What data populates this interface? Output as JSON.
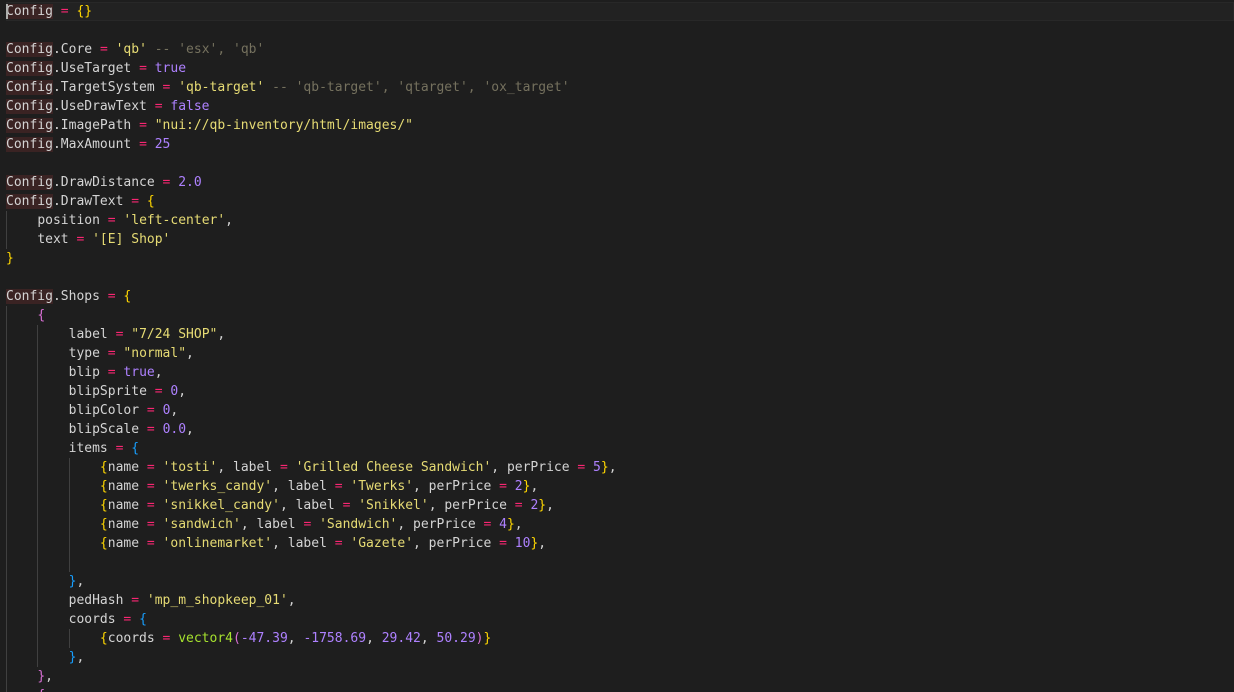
{
  "colors": {
    "background": "#1e1e1e",
    "plain": "#d4d4d4",
    "string": "#e6db74",
    "comment": "#75715e",
    "number": "#ae81ff",
    "operator": "#f92672",
    "bracket_gold": "#ffd700",
    "bracket_purple": "#da70d6",
    "bracket_blue": "#179fff",
    "function": "#a6e22e",
    "config_highlight": "#3a2323"
  },
  "editor": {
    "cursor_line": 0,
    "lines": [
      {
        "indent": 0,
        "tokens": [
          {
            "t": "Config",
            "c": "kw"
          },
          {
            "t": " "
          },
          {
            "t": "=",
            "c": "op"
          },
          {
            "t": " "
          },
          {
            "t": "{}",
            "c": "b1"
          }
        ]
      },
      {
        "indent": 0,
        "tokens": []
      },
      {
        "indent": 0,
        "tokens": [
          {
            "t": "Config",
            "c": "kw"
          },
          {
            "t": ".Core "
          },
          {
            "t": "=",
            "c": "op"
          },
          {
            "t": " "
          },
          {
            "t": "'qb'",
            "c": "str"
          },
          {
            "t": " -- 'esx', 'qb'",
            "c": "cm"
          }
        ]
      },
      {
        "indent": 0,
        "tokens": [
          {
            "t": "Config",
            "c": "kw"
          },
          {
            "t": ".UseTarget "
          },
          {
            "t": "=",
            "c": "op"
          },
          {
            "t": " "
          },
          {
            "t": "true",
            "c": "num"
          }
        ]
      },
      {
        "indent": 0,
        "tokens": [
          {
            "t": "Config",
            "c": "kw"
          },
          {
            "t": ".TargetSystem "
          },
          {
            "t": "=",
            "c": "op"
          },
          {
            "t": " "
          },
          {
            "t": "'qb-target'",
            "c": "str"
          },
          {
            "t": " -- 'qb-target', 'qtarget', 'ox_target'",
            "c": "cm"
          }
        ]
      },
      {
        "indent": 0,
        "tokens": [
          {
            "t": "Config",
            "c": "kw"
          },
          {
            "t": ".UseDrawText "
          },
          {
            "t": "=",
            "c": "op"
          },
          {
            "t": " "
          },
          {
            "t": "false",
            "c": "num"
          }
        ]
      },
      {
        "indent": 0,
        "tokens": [
          {
            "t": "Config",
            "c": "kw"
          },
          {
            "t": ".ImagePath "
          },
          {
            "t": "=",
            "c": "op"
          },
          {
            "t": " "
          },
          {
            "t": "\"nui://qb-inventory/html/images/\"",
            "c": "str"
          }
        ]
      },
      {
        "indent": 0,
        "tokens": [
          {
            "t": "Config",
            "c": "kw"
          },
          {
            "t": ".MaxAmount "
          },
          {
            "t": "=",
            "c": "op"
          },
          {
            "t": " "
          },
          {
            "t": "25",
            "c": "num"
          }
        ]
      },
      {
        "indent": 0,
        "tokens": []
      },
      {
        "indent": 0,
        "tokens": [
          {
            "t": "Config",
            "c": "kw"
          },
          {
            "t": ".DrawDistance "
          },
          {
            "t": "=",
            "c": "op"
          },
          {
            "t": " "
          },
          {
            "t": "2.0",
            "c": "num"
          }
        ]
      },
      {
        "indent": 0,
        "tokens": [
          {
            "t": "Config",
            "c": "kw"
          },
          {
            "t": ".DrawText "
          },
          {
            "t": "=",
            "c": "op"
          },
          {
            "t": " "
          },
          {
            "t": "{",
            "c": "b1"
          }
        ]
      },
      {
        "indent": 1,
        "tokens": [
          {
            "t": "position "
          },
          {
            "t": "=",
            "c": "op"
          },
          {
            "t": " "
          },
          {
            "t": "'left-center'",
            "c": "str"
          },
          {
            "t": ","
          }
        ]
      },
      {
        "indent": 1,
        "tokens": [
          {
            "t": "text "
          },
          {
            "t": "=",
            "c": "op"
          },
          {
            "t": " "
          },
          {
            "t": "'[E] Shop'",
            "c": "str"
          }
        ]
      },
      {
        "indent": 0,
        "tokens": [
          {
            "t": "}",
            "c": "b1"
          }
        ]
      },
      {
        "indent": 0,
        "tokens": []
      },
      {
        "indent": 0,
        "tokens": [
          {
            "t": "Config",
            "c": "kw"
          },
          {
            "t": ".Shops "
          },
          {
            "t": "=",
            "c": "op"
          },
          {
            "t": " "
          },
          {
            "t": "{",
            "c": "b1"
          }
        ]
      },
      {
        "indent": 1,
        "tokens": [
          {
            "t": "{",
            "c": "b2"
          }
        ]
      },
      {
        "indent": 2,
        "tokens": [
          {
            "t": "label "
          },
          {
            "t": "=",
            "c": "op"
          },
          {
            "t": " "
          },
          {
            "t": "\"7/24 SHOP\"",
            "c": "str"
          },
          {
            "t": ","
          }
        ]
      },
      {
        "indent": 2,
        "tokens": [
          {
            "t": "type "
          },
          {
            "t": "=",
            "c": "op"
          },
          {
            "t": " "
          },
          {
            "t": "\"normal\"",
            "c": "str"
          },
          {
            "t": ","
          }
        ]
      },
      {
        "indent": 2,
        "tokens": [
          {
            "t": "blip "
          },
          {
            "t": "=",
            "c": "op"
          },
          {
            "t": " "
          },
          {
            "t": "true",
            "c": "num"
          },
          {
            "t": ","
          }
        ]
      },
      {
        "indent": 2,
        "tokens": [
          {
            "t": "blipSprite "
          },
          {
            "t": "=",
            "c": "op"
          },
          {
            "t": " "
          },
          {
            "t": "0",
            "c": "num"
          },
          {
            "t": ","
          }
        ]
      },
      {
        "indent": 2,
        "tokens": [
          {
            "t": "blipColor "
          },
          {
            "t": "=",
            "c": "op"
          },
          {
            "t": " "
          },
          {
            "t": "0",
            "c": "num"
          },
          {
            "t": ","
          }
        ]
      },
      {
        "indent": 2,
        "tokens": [
          {
            "t": "blipScale "
          },
          {
            "t": "=",
            "c": "op"
          },
          {
            "t": " "
          },
          {
            "t": "0.0",
            "c": "num"
          },
          {
            "t": ","
          }
        ]
      },
      {
        "indent": 2,
        "tokens": [
          {
            "t": "items "
          },
          {
            "t": "=",
            "c": "op"
          },
          {
            "t": " "
          },
          {
            "t": "{",
            "c": "b3"
          }
        ]
      },
      {
        "indent": 3,
        "tokens": [
          {
            "t": "{",
            "c": "b1"
          },
          {
            "t": "name "
          },
          {
            "t": "=",
            "c": "op"
          },
          {
            "t": " "
          },
          {
            "t": "'tosti'",
            "c": "str"
          },
          {
            "t": ", label "
          },
          {
            "t": "=",
            "c": "op"
          },
          {
            "t": " "
          },
          {
            "t": "'Grilled Cheese Sandwich'",
            "c": "str"
          },
          {
            "t": ", perPrice "
          },
          {
            "t": "=",
            "c": "op"
          },
          {
            "t": " "
          },
          {
            "t": "5",
            "c": "num"
          },
          {
            "t": "}",
            "c": "b1"
          },
          {
            "t": ","
          }
        ]
      },
      {
        "indent": 3,
        "tokens": [
          {
            "t": "{",
            "c": "b1"
          },
          {
            "t": "name "
          },
          {
            "t": "=",
            "c": "op"
          },
          {
            "t": " "
          },
          {
            "t": "'twerks_candy'",
            "c": "str"
          },
          {
            "t": ", label "
          },
          {
            "t": "=",
            "c": "op"
          },
          {
            "t": " "
          },
          {
            "t": "'Twerks'",
            "c": "str"
          },
          {
            "t": ", perPrice "
          },
          {
            "t": "=",
            "c": "op"
          },
          {
            "t": " "
          },
          {
            "t": "2",
            "c": "num"
          },
          {
            "t": "}",
            "c": "b1"
          },
          {
            "t": ","
          }
        ]
      },
      {
        "indent": 3,
        "tokens": [
          {
            "t": "{",
            "c": "b1"
          },
          {
            "t": "name "
          },
          {
            "t": "=",
            "c": "op"
          },
          {
            "t": " "
          },
          {
            "t": "'snikkel_candy'",
            "c": "str"
          },
          {
            "t": ", label "
          },
          {
            "t": "=",
            "c": "op"
          },
          {
            "t": " "
          },
          {
            "t": "'Snikkel'",
            "c": "str"
          },
          {
            "t": ", perPrice "
          },
          {
            "t": "=",
            "c": "op"
          },
          {
            "t": " "
          },
          {
            "t": "2",
            "c": "num"
          },
          {
            "t": "}",
            "c": "b1"
          },
          {
            "t": ","
          }
        ]
      },
      {
        "indent": 3,
        "tokens": [
          {
            "t": "{",
            "c": "b1"
          },
          {
            "t": "name "
          },
          {
            "t": "=",
            "c": "op"
          },
          {
            "t": " "
          },
          {
            "t": "'sandwich'",
            "c": "str"
          },
          {
            "t": ", label "
          },
          {
            "t": "=",
            "c": "op"
          },
          {
            "t": " "
          },
          {
            "t": "'Sandwich'",
            "c": "str"
          },
          {
            "t": ", perPrice "
          },
          {
            "t": "=",
            "c": "op"
          },
          {
            "t": " "
          },
          {
            "t": "4",
            "c": "num"
          },
          {
            "t": "}",
            "c": "b1"
          },
          {
            "t": ","
          }
        ]
      },
      {
        "indent": 3,
        "tokens": [
          {
            "t": "{",
            "c": "b1"
          },
          {
            "t": "name "
          },
          {
            "t": "=",
            "c": "op"
          },
          {
            "t": " "
          },
          {
            "t": "'onlinemarket'",
            "c": "str"
          },
          {
            "t": ", label "
          },
          {
            "t": "=",
            "c": "op"
          },
          {
            "t": " "
          },
          {
            "t": "'Gazete'",
            "c": "str"
          },
          {
            "t": ", perPrice "
          },
          {
            "t": "=",
            "c": "op"
          },
          {
            "t": " "
          },
          {
            "t": "10",
            "c": "num"
          },
          {
            "t": "}",
            "c": "b1"
          },
          {
            "t": ","
          }
        ]
      },
      {
        "indent": 3,
        "tokens": []
      },
      {
        "indent": 2,
        "tokens": [
          {
            "t": "}",
            "c": "b3"
          },
          {
            "t": ","
          }
        ]
      },
      {
        "indent": 2,
        "tokens": [
          {
            "t": "pedHash "
          },
          {
            "t": "=",
            "c": "op"
          },
          {
            "t": " "
          },
          {
            "t": "'mp_m_shopkeep_01'",
            "c": "str"
          },
          {
            "t": ","
          }
        ]
      },
      {
        "indent": 2,
        "tokens": [
          {
            "t": "coords "
          },
          {
            "t": "=",
            "c": "op"
          },
          {
            "t": " "
          },
          {
            "t": "{",
            "c": "b3"
          }
        ]
      },
      {
        "indent": 3,
        "tokens": [
          {
            "t": "{",
            "c": "b1"
          },
          {
            "t": "coords "
          },
          {
            "t": "=",
            "c": "op"
          },
          {
            "t": " "
          },
          {
            "t": "vector4",
            "c": "fn"
          },
          {
            "t": "(",
            "c": "b2"
          },
          {
            "t": "-47.39",
            "c": "num"
          },
          {
            "t": ", "
          },
          {
            "t": "-1758.69",
            "c": "num"
          },
          {
            "t": ", "
          },
          {
            "t": "29.42",
            "c": "num"
          },
          {
            "t": ", "
          },
          {
            "t": "50.29",
            "c": "num"
          },
          {
            "t": ")",
            "c": "b2"
          },
          {
            "t": "}",
            "c": "b1"
          }
        ]
      },
      {
        "indent": 2,
        "tokens": [
          {
            "t": "}",
            "c": "b3"
          },
          {
            "t": ","
          }
        ]
      },
      {
        "indent": 1,
        "tokens": [
          {
            "t": "}",
            "c": "b2"
          },
          {
            "t": ","
          }
        ]
      },
      {
        "indent": 1,
        "tokens": [
          {
            "t": "{",
            "c": "b2"
          }
        ]
      }
    ]
  }
}
